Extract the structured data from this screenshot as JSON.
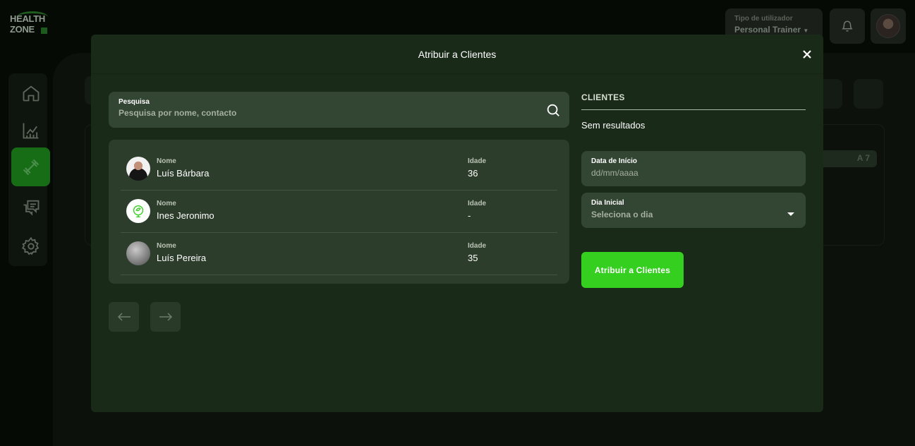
{
  "app": {
    "logo_line1": "HEALTH",
    "logo_line2": "ZONE",
    "user_type_label": "Tipo de utilizador",
    "user_type_value": "Personal Trainer",
    "background_chip": "A 7"
  },
  "sidebar": {
    "items": [
      {
        "icon": "home-icon"
      },
      {
        "icon": "chart-icon"
      },
      {
        "icon": "dumbbell-icon",
        "active": true
      },
      {
        "icon": "chat-icon"
      },
      {
        "icon": "gear-icon"
      }
    ]
  },
  "modal": {
    "title": "Atribuir a Clientes",
    "search": {
      "label": "Pesquisa",
      "placeholder": "Pesquisa por nome, contacto"
    },
    "table": {
      "name_header": "Nome",
      "age_header": "Idade",
      "rows": [
        {
          "name": "Luís Bárbara",
          "age": "36"
        },
        {
          "name": "Ines Jeronimo",
          "age": "-"
        },
        {
          "name": "Luís Pereira",
          "age": "35"
        }
      ]
    },
    "clients": {
      "heading": "CLIENTES",
      "empty": "Sem resultados"
    },
    "start_date": {
      "label": "Data de Início",
      "placeholder": "dd/mm/aaaa"
    },
    "start_day": {
      "label": "Dia Inicial",
      "value": "Seleciona o dia"
    },
    "submit_label": "Atribuir a Clientes"
  },
  "colors": {
    "accent": "#35d01f",
    "modal_bg": "#1a2a19",
    "field_bg": "#334533"
  }
}
